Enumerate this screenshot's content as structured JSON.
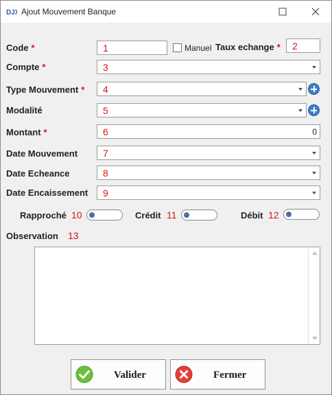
{
  "window": {
    "title": "Ajout Mouvement Banque",
    "logo_text": "DJX"
  },
  "form": {
    "code": {
      "label": "Code",
      "value": "1",
      "required": "*"
    },
    "manuel": {
      "label": "Manuel"
    },
    "taux": {
      "label": "Taux echange",
      "value": "2",
      "required": "*"
    },
    "compte": {
      "label": "Compte",
      "value": "3",
      "required": "*"
    },
    "type_mouvement": {
      "label": "Type Mouvement",
      "value": "4",
      "required": "*"
    },
    "modalite": {
      "label": "Modalité",
      "value": "5"
    },
    "montant": {
      "label": "Montant",
      "value": "6",
      "amount": "0",
      "required": "*"
    },
    "date_mouvement": {
      "label": "Date Mouvement",
      "value": "7"
    },
    "date_echeance": {
      "label": "Date Echeance",
      "value": "8"
    },
    "date_encaissement": {
      "label": "Date Encaissement",
      "value": "9"
    },
    "rapproche": {
      "label": "Rapproché",
      "value": "10"
    },
    "credit": {
      "label": "Crédit",
      "value": "11"
    },
    "debit": {
      "label": "Débit",
      "value": "12"
    },
    "observation": {
      "label": "Observation",
      "value": "13"
    }
  },
  "buttons": {
    "valider": "Valider",
    "fermer": "Fermer"
  },
  "icons": {
    "app": "app-logo-icon",
    "minimize": "maximize-icon",
    "close": "close-icon",
    "add": "plus-circle-icon",
    "ok": "checkmark-icon",
    "cancel": "x-circle-icon"
  },
  "colors": {
    "required": "#dd1111",
    "add_button": "#3f7fc8",
    "ok_icon": "#6bbf3a",
    "cancel_icon": "#e0403a"
  }
}
